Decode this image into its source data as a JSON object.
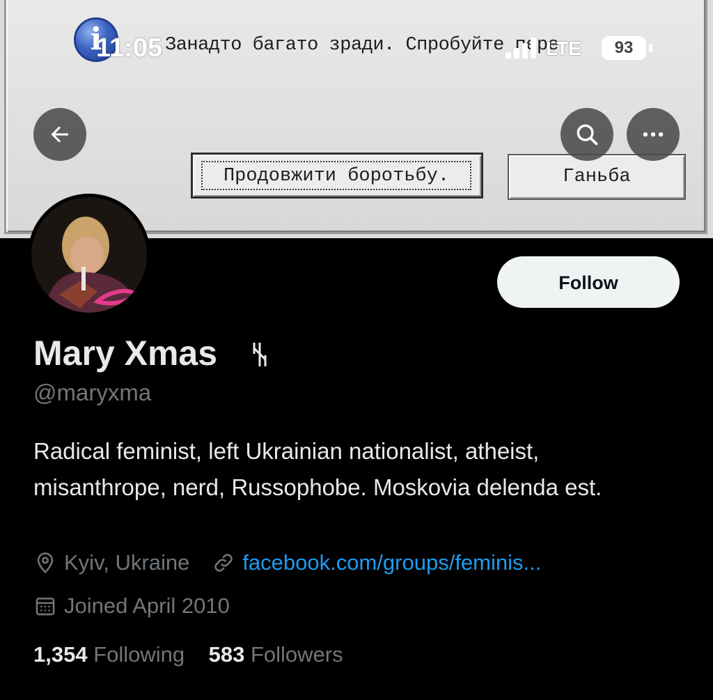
{
  "status_bar": {
    "time": "11:05",
    "network": "LTE",
    "battery": "93"
  },
  "banner": {
    "dialog_message": "Занадто багато зради. Спробуйте пере",
    "primary_button": "Продовжити боротьбу.",
    "secondary_button": "Ганьба"
  },
  "profile": {
    "display_name": "Mary Xmas",
    "name_glyph": "ᚾ",
    "handle": "@maryxma",
    "bio": "Radical feminist, left Ukrainian nationalist, atheist, misanthrope, nerd, Russophobe. Moskovia delenda est.",
    "location": "Kyiv, Ukraine",
    "link": "facebook.com/groups/feminis...",
    "joined": "Joined April 2010",
    "follow_label": "Follow"
  },
  "stats": {
    "following_count": "1,354",
    "following_label": "Following",
    "followers_count": "583",
    "followers_label": "Followers"
  },
  "icons": {
    "back": "arrow-left-icon",
    "search": "search-icon",
    "more": "more-horizontal-icon",
    "location": "location-pin-icon",
    "link": "link-icon",
    "calendar": "calendar-icon"
  },
  "colors": {
    "background": "#000000",
    "link": "#1d9bf0",
    "secondary_text": "#71767b",
    "follow_button_bg": "#eff3f4"
  }
}
